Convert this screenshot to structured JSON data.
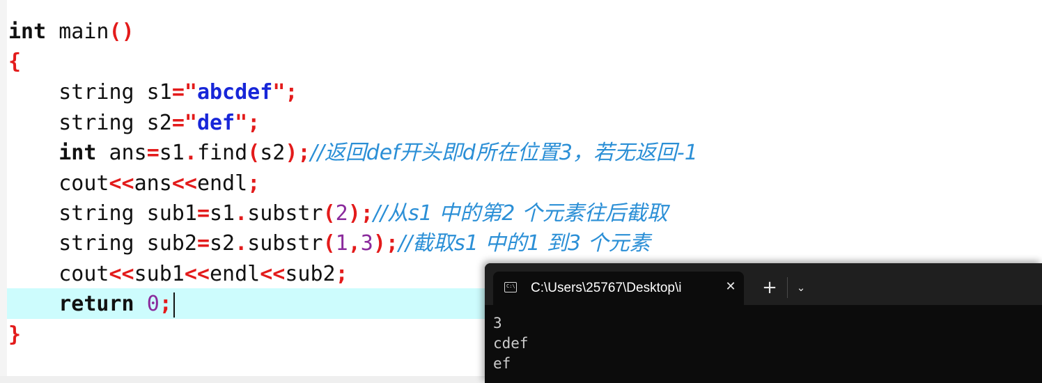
{
  "editor": {
    "lines": {
      "l1": {
        "kw": "int",
        "rest": " main",
        "open": "(",
        "close": ")"
      },
      "l2": {
        "brace": "{"
      },
      "l3": {
        "ind": "    ",
        "a": "string s1",
        "eq": "=",
        "q1": "\"",
        "s": "abcdef",
        "q2": "\"",
        "semi": ";"
      },
      "l4": {
        "ind": "    ",
        "a": "string s2",
        "eq": "=",
        "q1": "\"",
        "s": "def",
        "q2": "\"",
        "semi": ";"
      },
      "l5": {
        "ind": "    ",
        "kw": "int",
        "a": " ans",
        "eq": "=",
        "b": "s1",
        "dot": ".",
        "c": "find",
        "op": "(",
        "d": "s2",
        "cp": ")",
        "semi": ";",
        "cm": "//返回def开头即d所在位置3，若无返回-1"
      },
      "l6": {
        "ind": "    ",
        "a": "cout",
        "s1": "<<",
        "b": "ans",
        "s2": "<<",
        "c": "endl",
        "semi": ";"
      },
      "l7": {
        "ind": "    ",
        "a": "string sub1",
        "eq": "=",
        "b": "s1",
        "dot": ".",
        "c": "substr",
        "op": "(",
        "n": "2",
        "cp": ")",
        "semi": ";",
        "cm": "//从s1 中的第2 个元素往后截取"
      },
      "l8": {
        "ind": "    ",
        "a": "string sub2",
        "eq": "=",
        "b": "s2",
        "dot": ".",
        "c": "substr",
        "op": "(",
        "n1": "1",
        "comma": ",",
        "n2": "3",
        "cp": ")",
        "semi": ";",
        "cm": "//截取s1 中的1 到3 个元素"
      },
      "l9": {
        "ind": "    ",
        "a": "cout",
        "s1": "<<",
        "b": "sub1",
        "s2": "<<",
        "c": "endl",
        "s3": "<<",
        "d": "sub2",
        "semi": ";"
      },
      "l10": {
        "ind": "    ",
        "kw": "return",
        "sp": " ",
        "n": "0",
        "semi": ";"
      },
      "l11": {
        "brace": "}"
      }
    }
  },
  "terminal": {
    "tab_title": "C:\\Users\\25767\\Desktop\\i",
    "tab_icon_text": "C:\\",
    "close_glyph": "✕",
    "new_tab_glyph": "+",
    "dropdown_glyph": "⌄",
    "output": [
      "3",
      "cdef",
      "ef"
    ]
  },
  "colors": {
    "keyword": "#111111",
    "operator": "#e31b1b",
    "string": "#1726d8",
    "number": "#8a2a9c",
    "comment": "#2b8fd6",
    "current_line": "#cdfcfd",
    "terminal_bg": "#0c0c0c"
  }
}
